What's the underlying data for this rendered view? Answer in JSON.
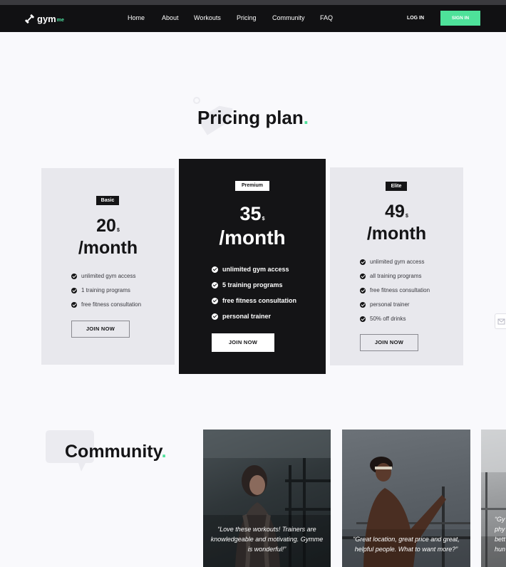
{
  "nav": {
    "logo_main": "gym",
    "logo_sub": "me",
    "links": [
      "Home",
      "About",
      "Workouts",
      "Pricing",
      "Community",
      "FAQ"
    ],
    "login": "LOG IN",
    "signin": "SIGN IN"
  },
  "pricing": {
    "title": "Pricing plan",
    "title_dot": ".",
    "plans": [
      {
        "badge": "Basic",
        "price": "20",
        "currency": "$",
        "period": "/month",
        "features": [
          "unlimited gym access",
          "1 training programs",
          "free fitness consultation"
        ],
        "cta": "JOIN NOW"
      },
      {
        "badge": "Premium",
        "price": "35",
        "currency": "$",
        "period": "/month",
        "features": [
          "unlimited gym access",
          "5 training programs",
          "free fitness consultation",
          "personal trainer"
        ],
        "cta": "JOIN NOW"
      },
      {
        "badge": "Elite",
        "price": "49",
        "currency": "$",
        "period": "/month",
        "features": [
          "unlimited gym access",
          "all training programs",
          "free fitness consultation",
          "personal trainer",
          "50% off drinks"
        ],
        "cta": "JOIN NOW"
      }
    ]
  },
  "community": {
    "title": "Community",
    "title_dot": ".",
    "testimonials": [
      {
        "quote": "“Love these workouts! Trainers are knowledgeable and motivating. Gymme is wonderful!”"
      },
      {
        "quote": "“Great location, great price and great, helpful people. What to want more?”"
      },
      {
        "quote": "“Gy phy bett hun"
      }
    ]
  },
  "colors": {
    "accent": "#4ee29a",
    "dark": "#141416",
    "card_light": "#e8e8ed",
    "page_bg": "#f9f9fc"
  }
}
